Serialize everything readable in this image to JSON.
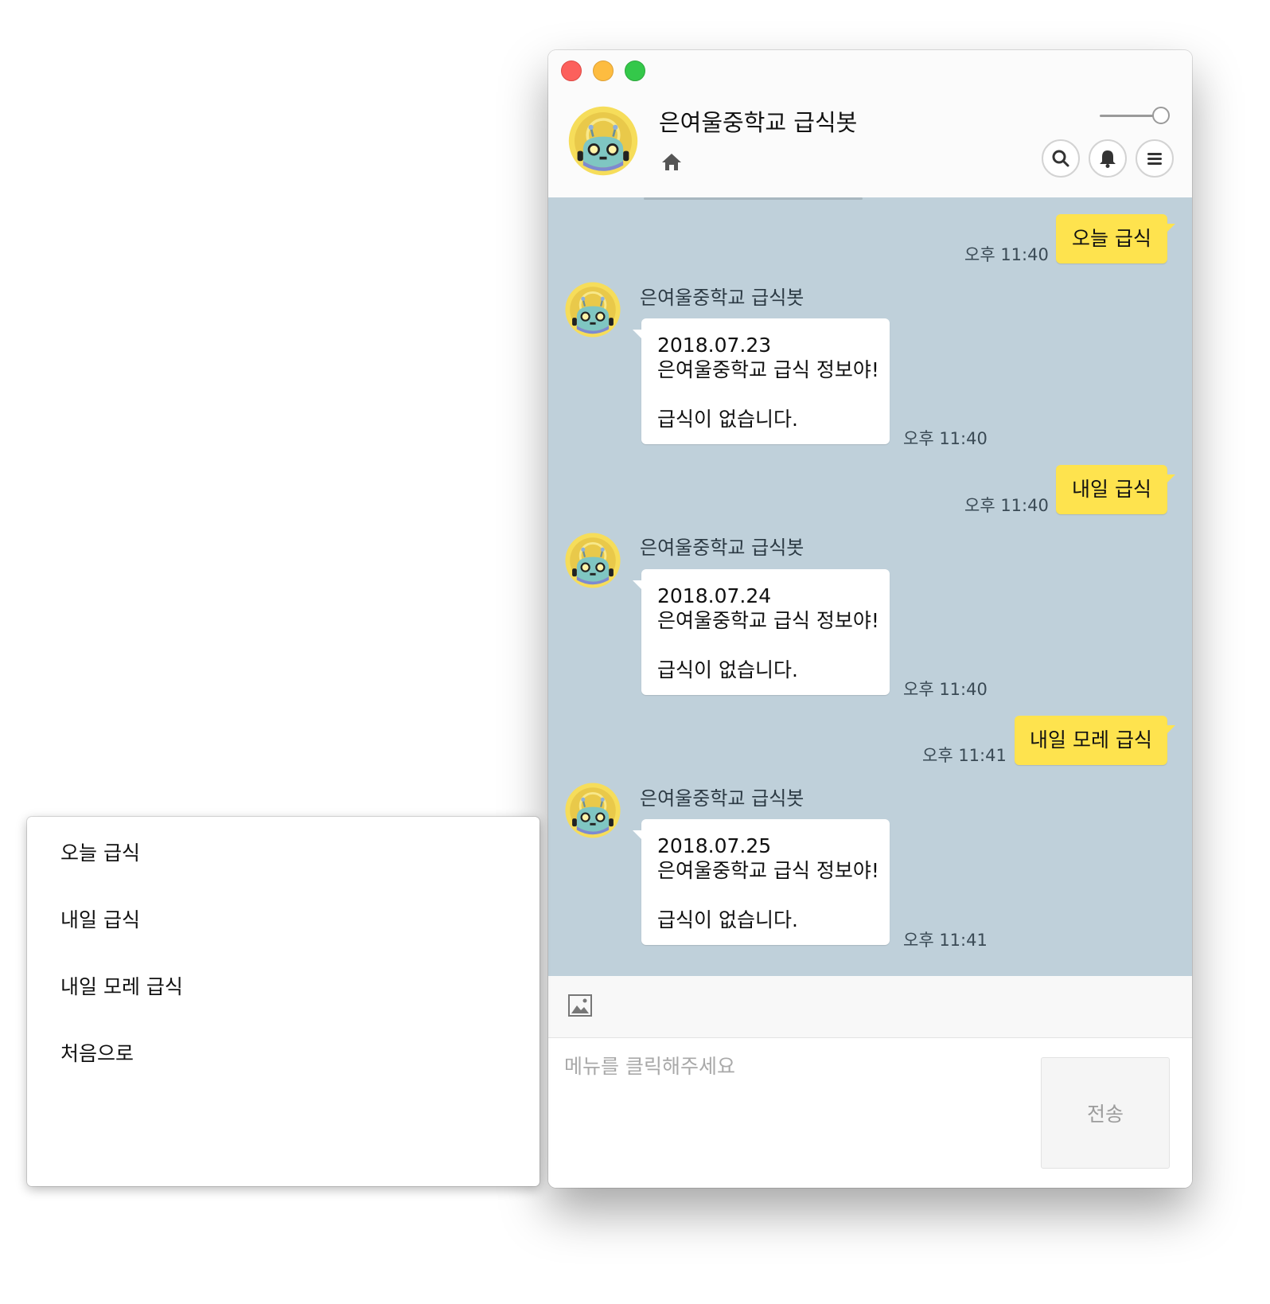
{
  "chatroom": {
    "title": "은여울중학교 급식봇"
  },
  "messages": [
    {
      "from": "me",
      "text": "오늘 급식",
      "time": "오후 11:40"
    },
    {
      "from": "bot",
      "sender": "은여울중학교 급식봇",
      "date": "2018.07.23",
      "line2": "은여울중학교 급식 정보야!",
      "line3": "급식이 없습니다.",
      "time": "오후 11:40"
    },
    {
      "from": "me",
      "text": "내일 급식",
      "time": "오후 11:40"
    },
    {
      "from": "bot",
      "sender": "은여울중학교 급식봇",
      "date": "2018.07.24",
      "line2": "은여울중학교 급식 정보야!",
      "line3": "급식이 없습니다.",
      "time": "오후 11:40"
    },
    {
      "from": "me",
      "text": "내일 모레 급식",
      "time": "오후 11:41"
    },
    {
      "from": "bot",
      "sender": "은여울중학교 급식봇",
      "date": "2018.07.25",
      "line2": "은여울중학교 급식 정보야!",
      "line3": "급식이 없습니다.",
      "time": "오후 11:41"
    }
  ],
  "input": {
    "placeholder": "메뉴를 클릭해주세요",
    "send_label": "전송"
  },
  "menu": {
    "items": [
      "오늘 급식",
      "내일 급식",
      "내일 모레 급식",
      "처음으로"
    ]
  },
  "icons": {
    "home": "home-icon",
    "search": "search-icon",
    "bell": "bell-icon",
    "menu": "hamburger-menu-icon",
    "image": "image-icon"
  },
  "colors": {
    "chat_background": "#bfd0da",
    "my_bubble": "#fee34e",
    "bot_bubble": "#ffffff"
  }
}
